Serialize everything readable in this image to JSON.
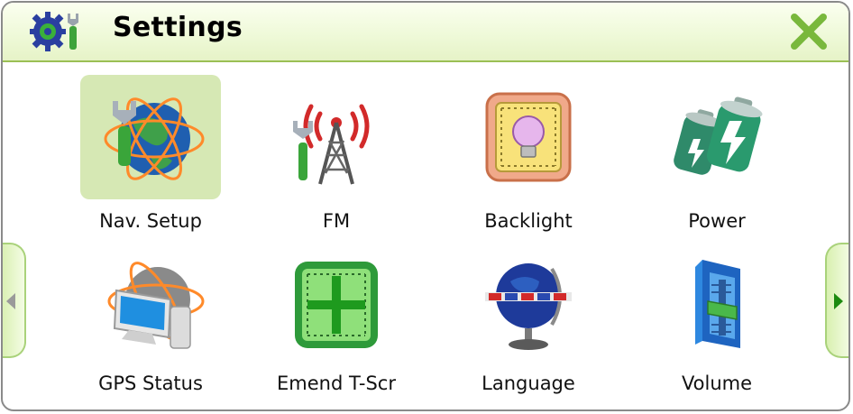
{
  "window": {
    "title": "Settings"
  },
  "icons": {
    "app": "settings-app-icon",
    "close": "close-icon",
    "prev": "left-arrow-icon",
    "next": "right-arrow-icon"
  },
  "colors": {
    "accent": "#a9d27a",
    "title_bar": "#eef9d7",
    "close": "#79b83c",
    "next_arrow": "#1c8a10",
    "prev_arrow": "#9a9a9a",
    "selected_tile": "#d6e8b4"
  },
  "items": [
    {
      "label": "Nav. Setup",
      "icon": "globe-wrench-icon",
      "selected": true
    },
    {
      "label": "FM",
      "icon": "antenna-tower-icon",
      "selected": false
    },
    {
      "label": "Backlight",
      "icon": "lightbulb-icon",
      "selected": false
    },
    {
      "label": "Power",
      "icon": "battery-icon",
      "selected": false
    },
    {
      "label": "GPS Status",
      "icon": "monitor-globe-icon",
      "selected": false
    },
    {
      "label": "Emend T-Scr",
      "icon": "crosshair-icon",
      "selected": false
    },
    {
      "label": "Language",
      "icon": "language-globe-icon",
      "selected": false
    },
    {
      "label": "Volume",
      "icon": "volume-slider-icon",
      "selected": false
    }
  ]
}
